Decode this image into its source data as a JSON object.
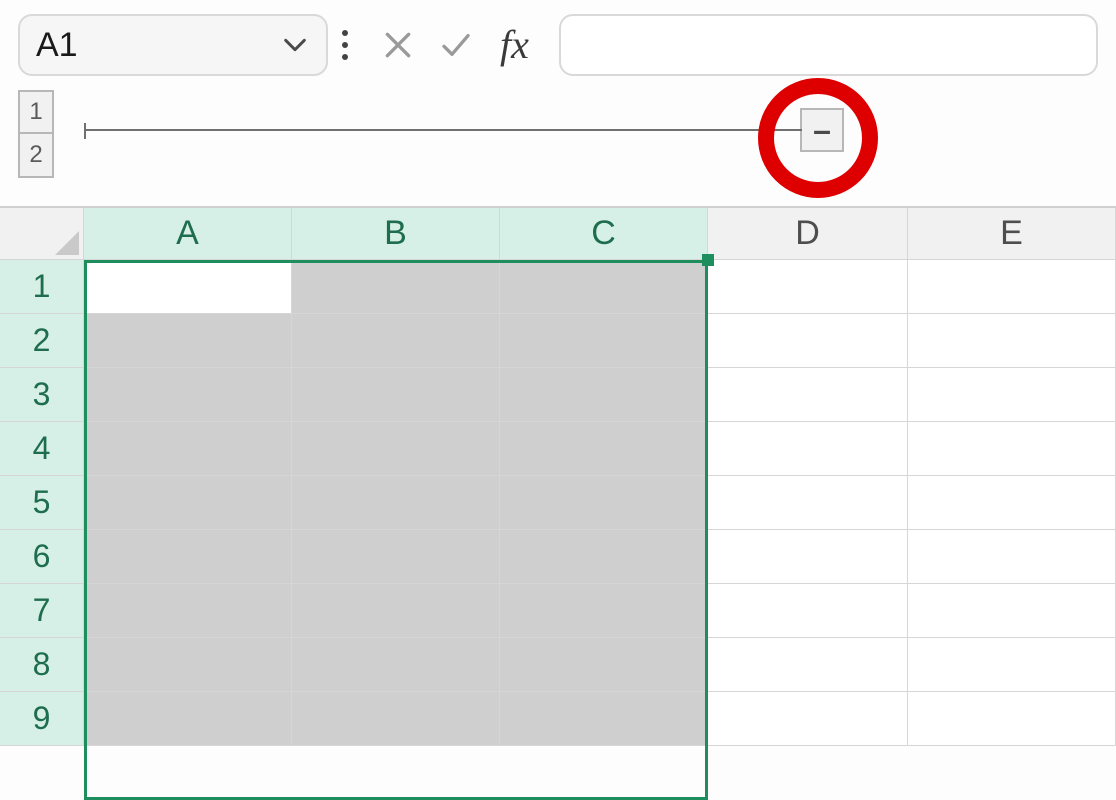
{
  "formula_bar": {
    "name_box": "A1",
    "fx_label": "fx",
    "formula_value": ""
  },
  "outline": {
    "levels": [
      "1",
      "2"
    ],
    "collapse_symbol": "–"
  },
  "columns": [
    "A",
    "B",
    "C",
    "D",
    "E"
  ],
  "rows": [
    "1",
    "2",
    "3",
    "4",
    "5",
    "6",
    "7",
    "8",
    "9"
  ],
  "selected_columns": [
    "A",
    "B",
    "C"
  ],
  "active_cell": "A1",
  "colors": {
    "selection_border": "#1e8e5e",
    "highlight_circle": "#de0000",
    "header_selected_bg": "#d6efe7"
  }
}
